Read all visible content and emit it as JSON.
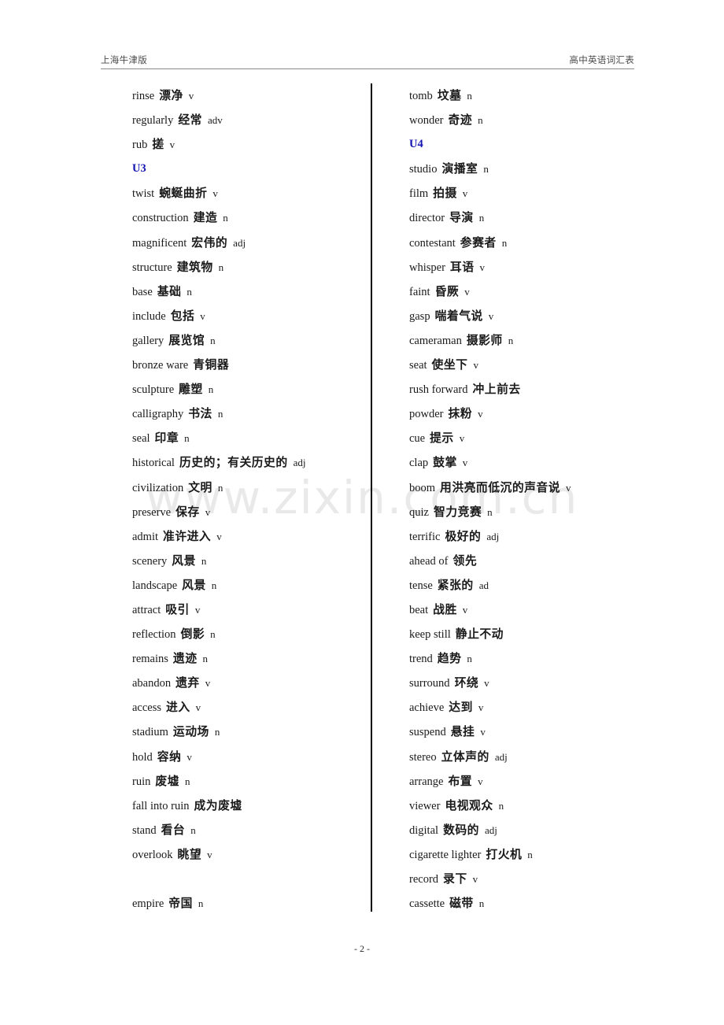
{
  "header": {
    "left": "上海牛津版",
    "right": "高中英语词汇表"
  },
  "watermark": "www.zixin.com.cn",
  "footer": {
    "page_number": "- 2 -"
  },
  "colors": {
    "unit_heading": "#1414b4",
    "text": "#1a1a1a",
    "header_text": "#4a4a4a",
    "watermark": "#e9e9e9",
    "divider": "#000000"
  },
  "columns": {
    "left": [
      {
        "type": "entry",
        "en": "rinse",
        "cn": "漂净",
        "pos": "v"
      },
      {
        "type": "entry",
        "en": "regularly",
        "cn": "经常",
        "pos": "adv"
      },
      {
        "type": "entry",
        "en": "rub",
        "cn": "搓",
        "pos": "v"
      },
      {
        "type": "unit",
        "label": "U3"
      },
      {
        "type": "entry",
        "en": "twist",
        "cn": "蜿蜒曲折",
        "pos": "v"
      },
      {
        "type": "entry",
        "en": "construction",
        "cn": "建造",
        "pos": "n"
      },
      {
        "type": "entry",
        "en": "magnificent",
        "cn": "宏伟的",
        "pos": "adj"
      },
      {
        "type": "entry",
        "en": "structure",
        "cn": "建筑物",
        "pos": "n"
      },
      {
        "type": "entry",
        "en": "base",
        "cn": "基础",
        "pos": "n"
      },
      {
        "type": "entry",
        "en": "include",
        "cn": "包括",
        "pos": "v"
      },
      {
        "type": "entry",
        "en": "gallery",
        "cn": "展览馆",
        "pos": "n"
      },
      {
        "type": "entry",
        "en": "bronze ware",
        "cn": "青铜器",
        "pos": ""
      },
      {
        "type": "entry",
        "en": "sculpture",
        "cn": "雕塑",
        "pos": "n"
      },
      {
        "type": "entry",
        "en": "calligraphy",
        "cn": "书法",
        "pos": "n"
      },
      {
        "type": "entry",
        "en": "seal",
        "cn": "印章",
        "pos": "n"
      },
      {
        "type": "entry",
        "en": "historical",
        "cn": "历史的；有关历史的",
        "pos": "adj"
      },
      {
        "type": "entry",
        "en": "civilization",
        "cn": "文明",
        "pos": "n"
      },
      {
        "type": "entry",
        "en": "preserve",
        "cn": "保存",
        "pos": "v"
      },
      {
        "type": "entry",
        "en": "admit",
        "cn": "准许进入",
        "pos": "v"
      },
      {
        "type": "entry",
        "en": "scenery",
        "cn": "风景",
        "pos": "n"
      },
      {
        "type": "entry",
        "en": "landscape",
        "cn": "风景",
        "pos": "n"
      },
      {
        "type": "entry",
        "en": "attract",
        "cn": "吸引",
        "pos": "v"
      },
      {
        "type": "entry",
        "en": "reflection",
        "cn": "倒影",
        "pos": "n"
      },
      {
        "type": "entry",
        "en": "remains",
        "cn": "遗迹",
        "pos": "n"
      },
      {
        "type": "entry",
        "en": "abandon",
        "cn": "遗弃",
        "pos": "v"
      },
      {
        "type": "entry",
        "en": "access",
        "cn": "进入",
        "pos": "v"
      },
      {
        "type": "entry",
        "en": "stadium",
        "cn": "运动场",
        "pos": "n"
      },
      {
        "type": "entry",
        "en": "hold",
        "cn": "容纳",
        "pos": "v"
      },
      {
        "type": "entry",
        "en": "ruin",
        "cn": "废墟",
        "pos": "n"
      },
      {
        "type": "entry",
        "en": "fall into ruin",
        "cn": "成为废墟",
        "pos": ""
      },
      {
        "type": "entry",
        "en": "stand",
        "cn": "看台",
        "pos": "n"
      },
      {
        "type": "entry",
        "en": "overlook",
        "cn": "眺望",
        "pos": "v"
      },
      {
        "type": "blank"
      },
      {
        "type": "entry",
        "en": "empire",
        "cn": "帝国",
        "pos": "n"
      }
    ],
    "right": [
      {
        "type": "entry",
        "en": "tomb",
        "cn": "坟墓",
        "pos": "n"
      },
      {
        "type": "entry",
        "en": "wonder",
        "cn": "奇迹",
        "pos": "n"
      },
      {
        "type": "unit",
        "label": "U4"
      },
      {
        "type": "entry",
        "en": "studio",
        "cn": "演播室",
        "pos": "n"
      },
      {
        "type": "entry",
        "en": "film",
        "cn": "拍摄",
        "pos": "v"
      },
      {
        "type": "entry",
        "en": "director",
        "cn": "导演",
        "pos": "n"
      },
      {
        "type": "entry",
        "en": "contestant",
        "cn": "参赛者",
        "pos": "n"
      },
      {
        "type": "entry",
        "en": "whisper",
        "cn": "耳语",
        "pos": "v"
      },
      {
        "type": "entry",
        "en": "faint",
        "cn": "昏厥",
        "pos": "v"
      },
      {
        "type": "entry",
        "en": "gasp",
        "cn": "喘着气说",
        "pos": "v"
      },
      {
        "type": "entry",
        "en": "cameraman",
        "cn": "摄影师",
        "pos": "n"
      },
      {
        "type": "entry",
        "en": "seat",
        "cn": "使坐下",
        "pos": "v"
      },
      {
        "type": "entry",
        "en": "rush forward",
        "cn": "冲上前去",
        "pos": ""
      },
      {
        "type": "entry",
        "en": "powder",
        "cn": "抹粉",
        "pos": "v"
      },
      {
        "type": "entry",
        "en": "cue",
        "cn": "提示",
        "pos": "v"
      },
      {
        "type": "entry",
        "en": "clap",
        "cn": "鼓掌",
        "pos": "v"
      },
      {
        "type": "entry",
        "en": "boom",
        "cn": "用洪亮而低沉的声音说",
        "pos": "v"
      },
      {
        "type": "entry",
        "en": "quiz",
        "cn": "智力竞赛",
        "pos": "n"
      },
      {
        "type": "entry",
        "en": "terrific",
        "cn": "极好的",
        "pos": "adj"
      },
      {
        "type": "entry",
        "en": "ahead of",
        "cn": "领先",
        "pos": ""
      },
      {
        "type": "entry",
        "en": "tense",
        "cn": "紧张的",
        "pos": "ad"
      },
      {
        "type": "entry",
        "en": "beat",
        "cn": "战胜",
        "pos": "v"
      },
      {
        "type": "entry",
        "en": "keep still",
        "cn": "静止不动",
        "pos": ""
      },
      {
        "type": "entry",
        "en": "trend",
        "cn": "趋势",
        "pos": "n"
      },
      {
        "type": "entry",
        "en": "surround",
        "cn": "环绕",
        "pos": "v"
      },
      {
        "type": "entry",
        "en": "achieve",
        "cn": "达到",
        "pos": "v"
      },
      {
        "type": "entry",
        "en": "suspend",
        "cn": "悬挂",
        "pos": "v"
      },
      {
        "type": "entry",
        "en": "stereo",
        "cn": "立体声的",
        "pos": "adj"
      },
      {
        "type": "entry",
        "en": "arrange",
        "cn": "布置",
        "pos": "v"
      },
      {
        "type": "entry",
        "en": "viewer",
        "cn": "电视观众",
        "pos": "n"
      },
      {
        "type": "entry",
        "en": "digital",
        "cn": "数码的",
        "pos": "adj"
      },
      {
        "type": "entry",
        "en": "cigarette lighter",
        "cn": "打火机",
        "pos": "n"
      },
      {
        "type": "entry",
        "en": "record",
        "cn": "录下",
        "pos": "v"
      },
      {
        "type": "entry",
        "en": "cassette",
        "cn": "磁带",
        "pos": "n"
      }
    ]
  }
}
